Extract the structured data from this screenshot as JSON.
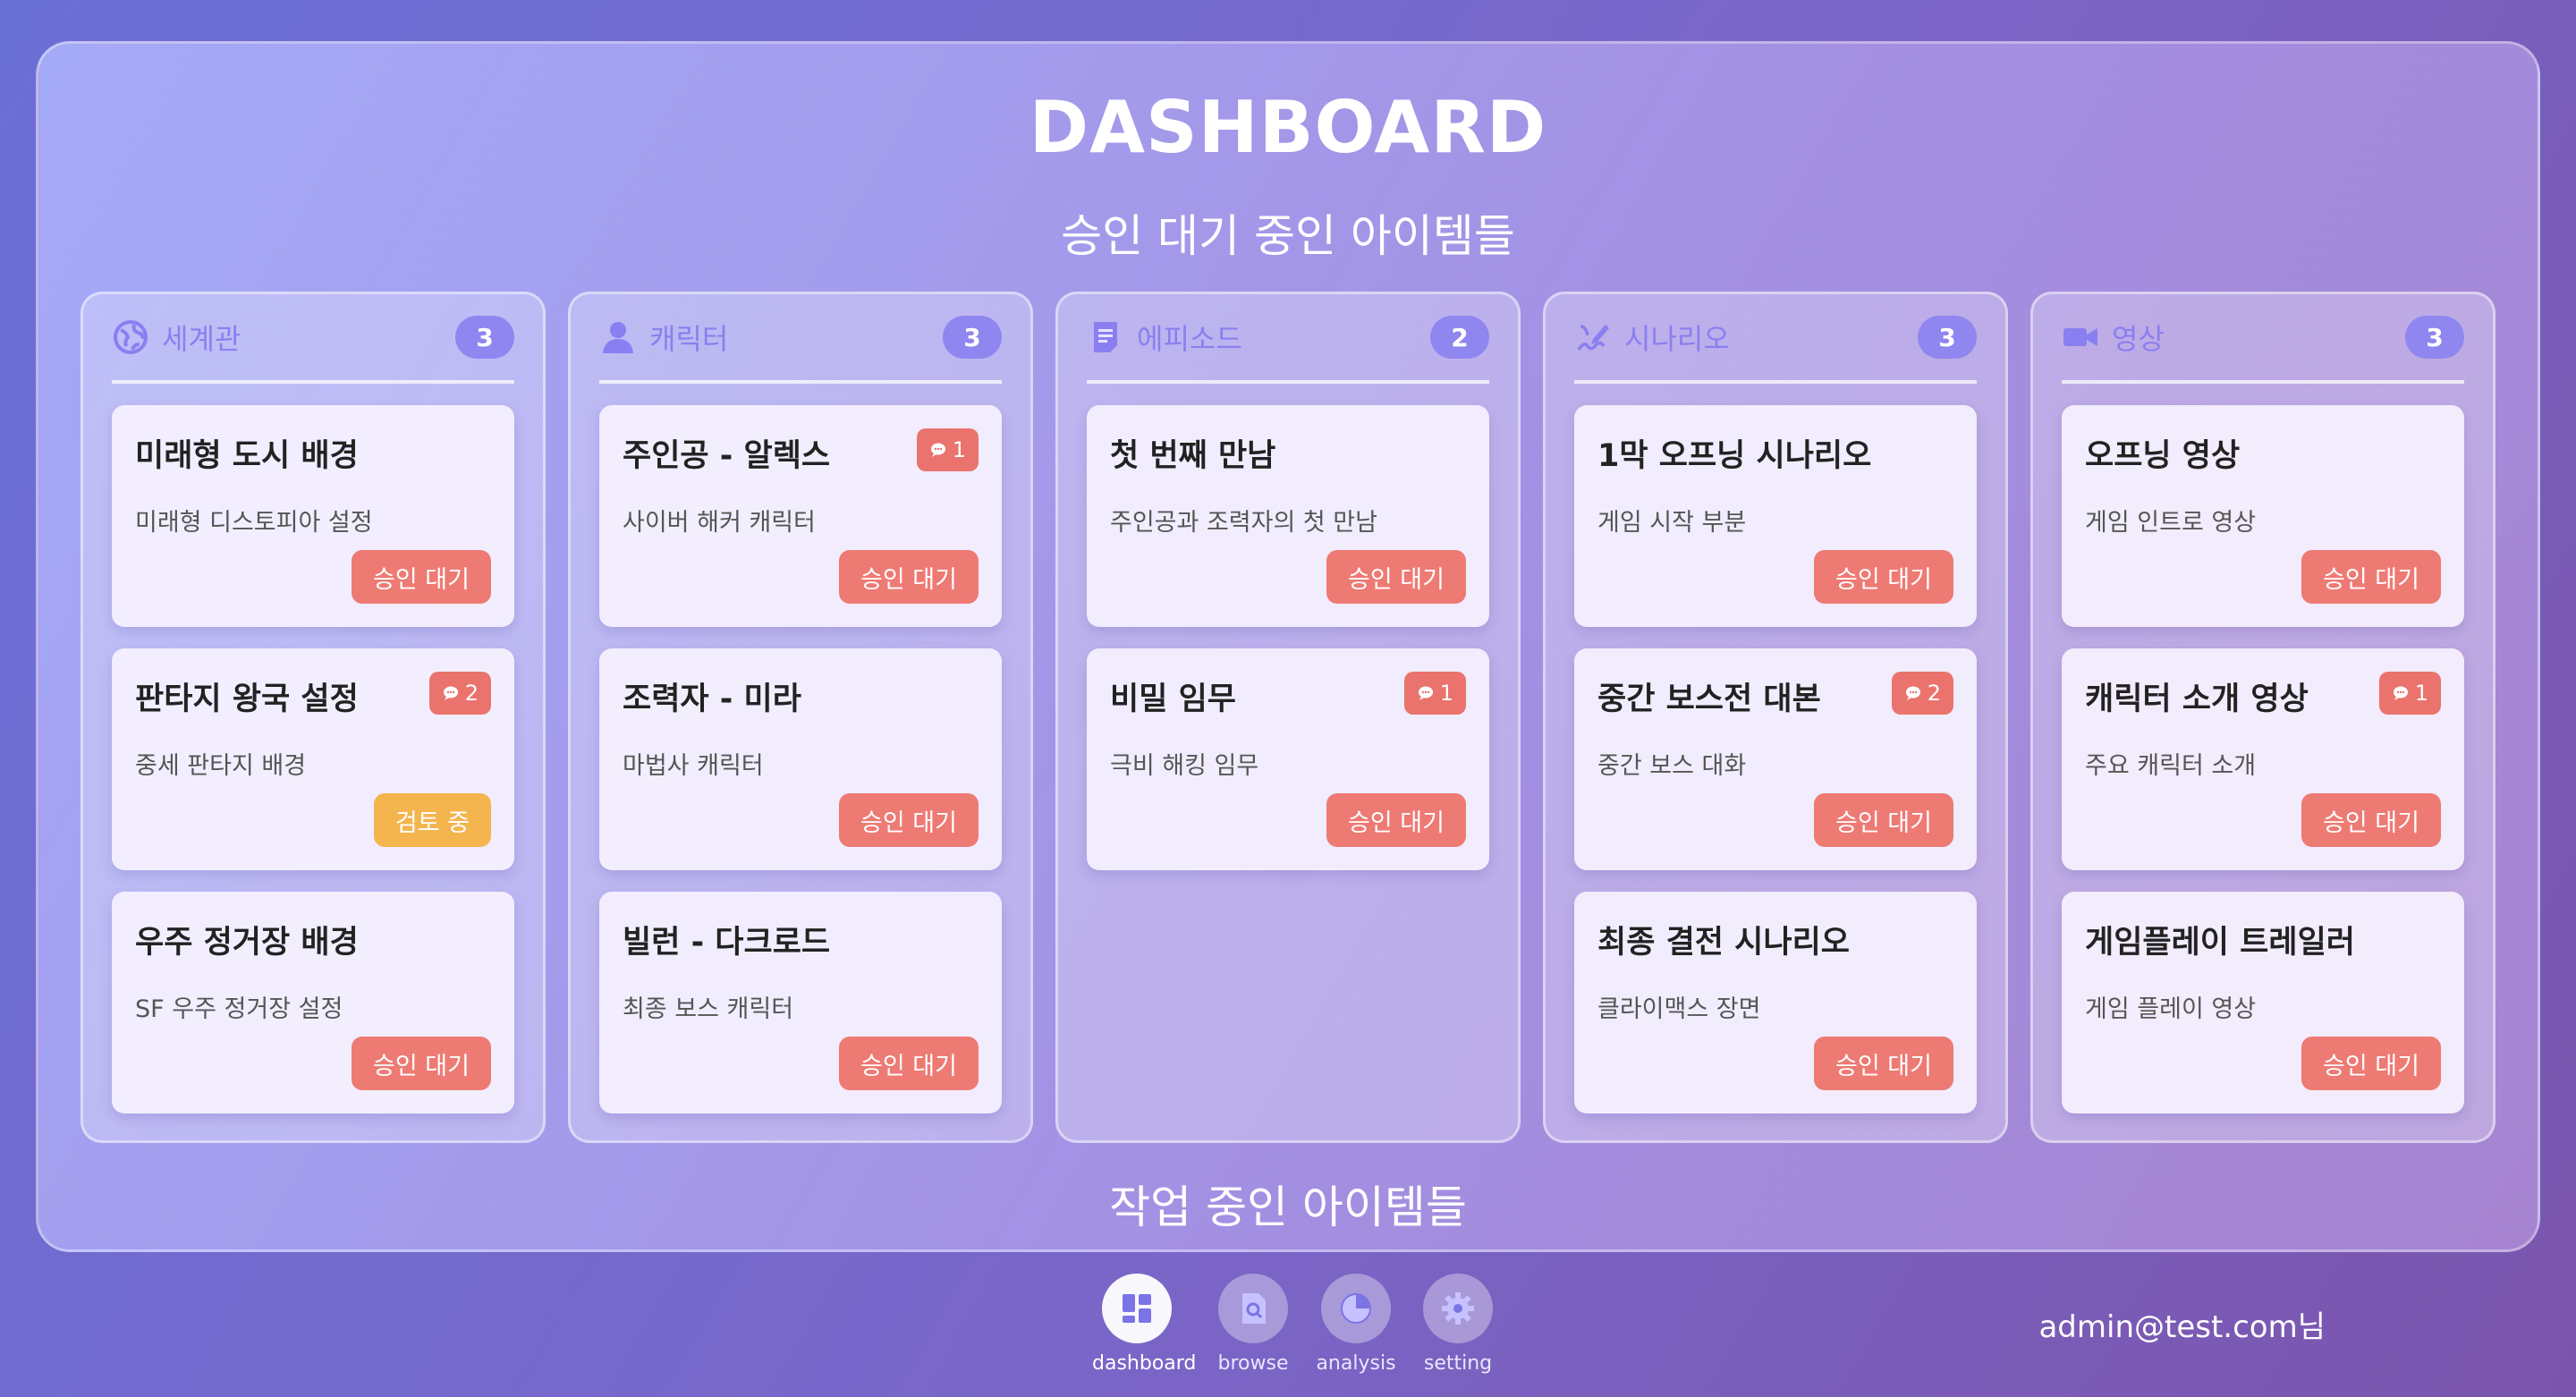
{
  "header": {
    "title": "DASHBOARD",
    "subtitle": "승인 대기 중인 아이템들",
    "subtitle_working": "작업 중인 아이템들"
  },
  "colors": {
    "accent": "#8f86f0",
    "pending": "#ee7a74",
    "review": "#f4b44e",
    "comment": "#ea736d"
  },
  "columns": [
    {
      "title": "세계관",
      "count": "3",
      "icon": "globe-icon",
      "cards": [
        {
          "title": "미래형 도시 배경",
          "desc": "미래형 디스토피아 설정",
          "status": "승인 대기",
          "comments": ""
        },
        {
          "title": "판타지 왕국 설정",
          "desc": "중세 판타지 배경",
          "status": "검토 중",
          "comments": "2"
        },
        {
          "title": "우주 정거장 배경",
          "desc": "SF 우주 정거장 설정",
          "status": "승인 대기",
          "comments": ""
        }
      ]
    },
    {
      "title": "캐릭터",
      "count": "3",
      "icon": "person-icon",
      "cards": [
        {
          "title": "주인공 - 알렉스",
          "desc": "사이버 해커 캐릭터",
          "status": "승인 대기",
          "comments": "1"
        },
        {
          "title": "조력자 - 미라",
          "desc": "마법사 캐릭터",
          "status": "승인 대기",
          "comments": ""
        },
        {
          "title": "빌런 - 다크로드",
          "desc": "최종 보스 캐릭터",
          "status": "승인 대기",
          "comments": ""
        }
      ]
    },
    {
      "title": "에피소드",
      "count": "2",
      "icon": "document-icon",
      "cards": [
        {
          "title": "첫 번째 만남",
          "desc": "주인공과 조력자의 첫 만남",
          "status": "승인 대기",
          "comments": ""
        },
        {
          "title": "비밀 임무",
          "desc": "극비 해킹 임무",
          "status": "승인 대기",
          "comments": "1"
        }
      ]
    },
    {
      "title": "시나리오",
      "count": "3",
      "icon": "signature-icon",
      "cards": [
        {
          "title": "1막 오프닝 시나리오",
          "desc": "게임 시작 부분",
          "status": "승인 대기",
          "comments": ""
        },
        {
          "title": "중간 보스전 대본",
          "desc": "중간 보스 대화",
          "status": "승인 대기",
          "comments": "2"
        },
        {
          "title": "최종 결전 시나리오",
          "desc": "클라이맥스 장면",
          "status": "승인 대기",
          "comments": ""
        }
      ]
    },
    {
      "title": "영상",
      "count": "3",
      "icon": "video-camera-icon",
      "cards": [
        {
          "title": "오프닝 영상",
          "desc": "게임 인트로 영상",
          "status": "승인 대기",
          "comments": ""
        },
        {
          "title": "캐릭터 소개 영상",
          "desc": "주요 캐릭터 소개",
          "status": "승인 대기",
          "comments": "1"
        },
        {
          "title": "게임플레이 트레일러",
          "desc": "게임 플레이 영상",
          "status": "승인 대기",
          "comments": ""
        }
      ]
    }
  ],
  "nav": [
    {
      "label": "dashboard",
      "icon": "dashboard-icon",
      "active": true
    },
    {
      "label": "browse",
      "icon": "browse-icon",
      "active": false
    },
    {
      "label": "analysis",
      "icon": "pie-chart-icon",
      "active": false
    },
    {
      "label": "setting",
      "icon": "gear-icon",
      "active": false
    }
  ],
  "user": {
    "label": "admin@test.com님"
  }
}
